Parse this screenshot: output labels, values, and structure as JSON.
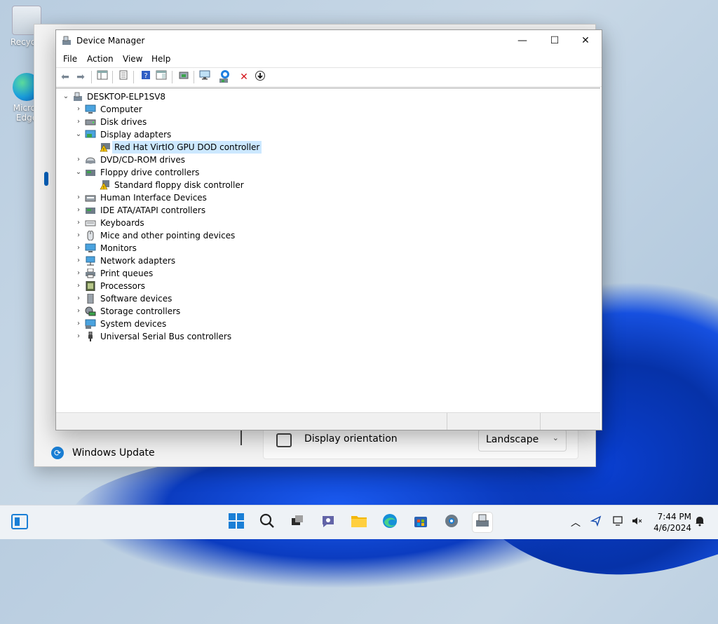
{
  "desktop": {
    "icons": [
      {
        "label": "Recycle",
        "icon": "recycle-bin-icon"
      },
      {
        "label": "Micros Edge",
        "icon": "edge-icon"
      }
    ]
  },
  "settings_bg": {
    "display_orientation_label": "Display orientation",
    "orientation_value": "Landscape",
    "windows_update_label": "Windows Update"
  },
  "window": {
    "title": "Device Manager",
    "controls": {
      "minimize": "—",
      "maximize": "☐",
      "close": "✕"
    },
    "menu": [
      "File",
      "Action",
      "View",
      "Help"
    ]
  },
  "toolbar_icons": [
    "back-icon",
    "forward-icon",
    "properties-pane-icon",
    "properties-icon",
    "help-icon",
    "show-hide-console-tree-icon",
    "update-driver-icon",
    "scan-hardware-icon",
    "enable-device-icon",
    "uninstall-device-icon",
    "disable-device-icon"
  ],
  "tree": {
    "root": "DESKTOP-ELP1SV8",
    "items": [
      {
        "label": "Computer",
        "expanded": false,
        "icon": "computer-icon"
      },
      {
        "label": "Disk drives",
        "expanded": false,
        "icon": "disk-drive-icon"
      },
      {
        "label": "Display adapters",
        "expanded": true,
        "icon": "display-adapter-icon",
        "children": [
          {
            "label": "Red Hat VirtIO GPU DOD controller",
            "warning": true,
            "selected": true
          }
        ]
      },
      {
        "label": "DVD/CD-ROM drives",
        "expanded": false,
        "icon": "dvd-drive-icon"
      },
      {
        "label": "Floppy drive controllers",
        "expanded": true,
        "icon": "floppy-controller-icon",
        "children": [
          {
            "label": "Standard floppy disk controller",
            "warning": true,
            "selected": false
          }
        ]
      },
      {
        "label": "Human Interface Devices",
        "expanded": false,
        "icon": "hid-icon"
      },
      {
        "label": "IDE ATA/ATAPI controllers",
        "expanded": false,
        "icon": "ide-controller-icon"
      },
      {
        "label": "Keyboards",
        "expanded": false,
        "icon": "keyboard-icon"
      },
      {
        "label": "Mice and other pointing devices",
        "expanded": false,
        "icon": "mouse-icon"
      },
      {
        "label": "Monitors",
        "expanded": false,
        "icon": "monitor-icon"
      },
      {
        "label": "Network adapters",
        "expanded": false,
        "icon": "network-adapter-icon"
      },
      {
        "label": "Print queues",
        "expanded": false,
        "icon": "printer-icon"
      },
      {
        "label": "Processors",
        "expanded": false,
        "icon": "processor-icon"
      },
      {
        "label": "Software devices",
        "expanded": false,
        "icon": "software-device-icon"
      },
      {
        "label": "Storage controllers",
        "expanded": false,
        "icon": "storage-controller-icon"
      },
      {
        "label": "System devices",
        "expanded": false,
        "icon": "system-device-icon"
      },
      {
        "label": "Universal Serial Bus controllers",
        "expanded": false,
        "icon": "usb-icon"
      }
    ]
  },
  "taskbar": {
    "apps": [
      "start-icon",
      "search-icon",
      "task-view-icon",
      "chat-icon",
      "file-explorer-icon",
      "edge-icon",
      "store-icon",
      "settings-icon",
      "device-manager-icon"
    ],
    "time": "7:44 PM",
    "date": "4/6/2024"
  },
  "colors": {
    "selection": "#cce8ff",
    "accent": "#005fb8",
    "warning": "#f5c400"
  }
}
